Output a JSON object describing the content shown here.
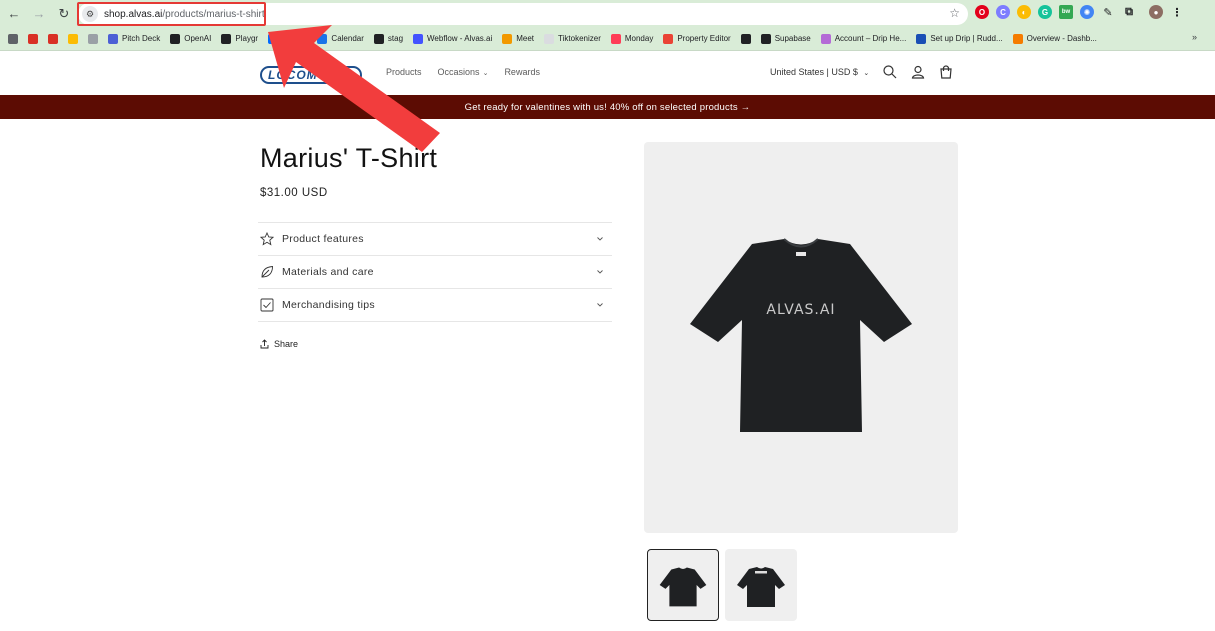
{
  "browser": {
    "url_host": "shop.alvas.ai",
    "url_path": "/products/marius-t-shirt",
    "bookmarks": [
      {
        "label": "",
        "color": "#5f6368"
      },
      {
        "label": "",
        "color": "#d93025"
      },
      {
        "label": "",
        "color": "#d93025"
      },
      {
        "label": "",
        "color": "#fbbc04"
      },
      {
        "label": "",
        "color": "#9aa0a6"
      },
      {
        "label": "Pitch Deck",
        "color": "#4c5fd5"
      },
      {
        "label": "OpenAI",
        "color": "#202124"
      },
      {
        "label": "Playgr",
        "color": "#202124"
      },
      {
        "label": "alendly",
        "color": "#006bff"
      },
      {
        "label": "Calendar",
        "color": "#1a73e8"
      },
      {
        "label": "stag",
        "color": "#202124"
      },
      {
        "label": "Webflow - Alvas.ai",
        "color": "#4353ff"
      },
      {
        "label": "Meet",
        "color": "#f29900"
      },
      {
        "label": "Tiktokenizer",
        "color": "#dadce0"
      },
      {
        "label": "Monday",
        "color": "#ff3d57"
      },
      {
        "label": "Property Editor",
        "color": "#ea4335"
      },
      {
        "label": "",
        "color": "#202124"
      },
      {
        "label": "Supabase",
        "color": "#202124"
      },
      {
        "label": "Account – Drip He...",
        "color": "#b46bd6"
      },
      {
        "label": "Set up Drip | Rudd...",
        "color": "#1a4fb5"
      },
      {
        "label": "Overview - Dashb...",
        "color": "#f57c00"
      }
    ],
    "more_bookmarks": "»"
  },
  "store": {
    "logo_text": "LOCOMOTIM",
    "nav": {
      "products": "Products",
      "occasions": "Occasions",
      "rewards": "Rewards"
    },
    "locale": "United States | USD $",
    "announcement": "Get ready for valentines with us! 40% off on selected products →"
  },
  "product": {
    "title": "Marius' T-Shirt",
    "price": "$31.00 USD",
    "accordion": [
      {
        "label": "Product features",
        "icon": "star-icon"
      },
      {
        "label": "Materials and care",
        "icon": "leaf-icon"
      },
      {
        "label": "Merchandising tips",
        "icon": "checkbox-icon"
      }
    ],
    "share_label": "Share",
    "shirt_print": "ALVAS.AI"
  },
  "colors": {
    "chrome_bg": "#d9ecd7",
    "announcement_bg": "#5c0c03",
    "annotation_red": "#e53935",
    "shirt": "#1f2123"
  }
}
